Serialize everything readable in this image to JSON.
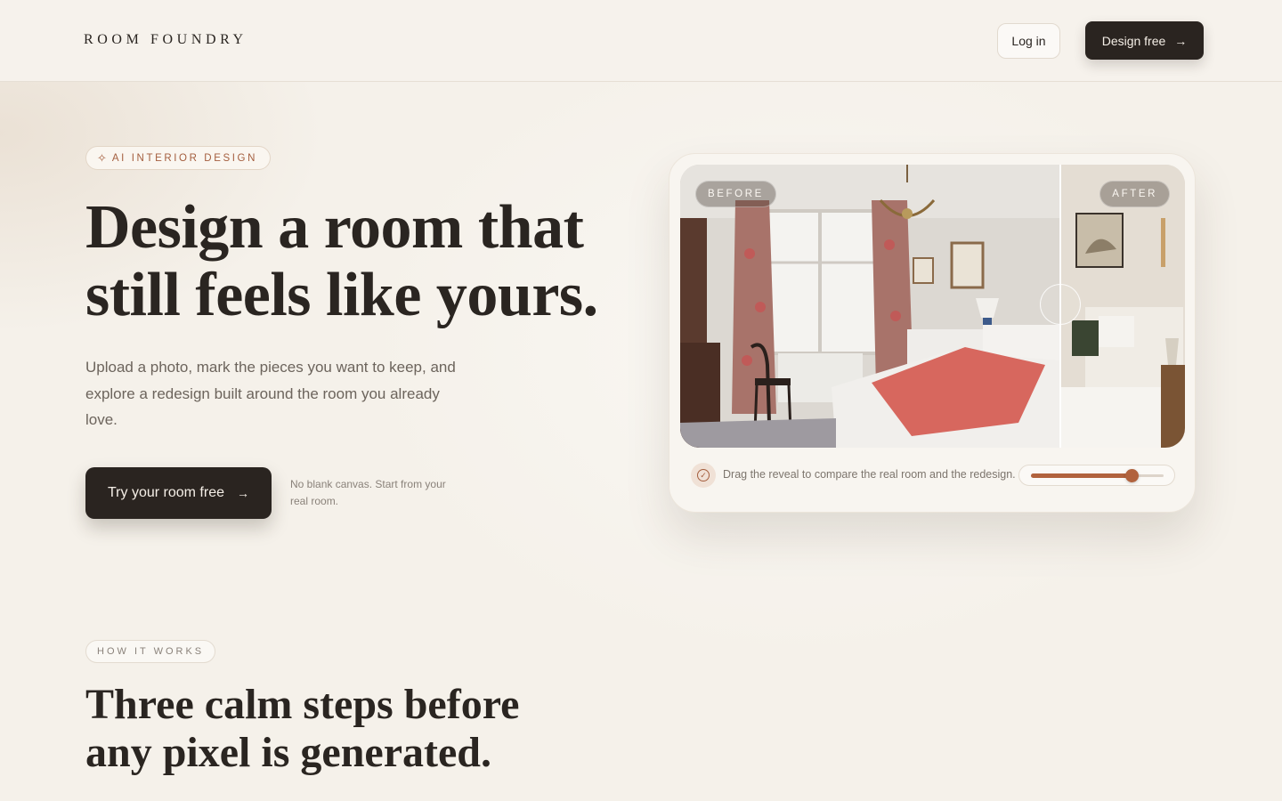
{
  "header": {
    "brand": "ROOM FOUNDRY",
    "login_label": "Log in",
    "design_label": "Design free"
  },
  "hero": {
    "badge": "AI INTERIOR DESIGN",
    "title": "Design a room that still feels like yours.",
    "subtitle": "Upload a photo, mark the pieces you want to keep, and explore a redesign built around the room you already love.",
    "cta_label": "Try your room free",
    "cta_note": "No blank canvas. Start from your real room."
  },
  "compare": {
    "before_label": "BEFORE",
    "after_label": "AFTER",
    "caption": "Drag the reveal to compare the real room and the redesign.",
    "slider_value": 0.76
  },
  "how_it_works": {
    "badge": "HOW IT WORKS",
    "title": "Three calm steps before any pixel is generated."
  },
  "icons": {
    "sparkle": "sparkle-icon",
    "arrow": "arrow-right-icon",
    "check": "check-circle-icon"
  },
  "colors": {
    "accent": "#a45e3e",
    "dark": "#2a2420",
    "background": "#f5f1ea"
  }
}
